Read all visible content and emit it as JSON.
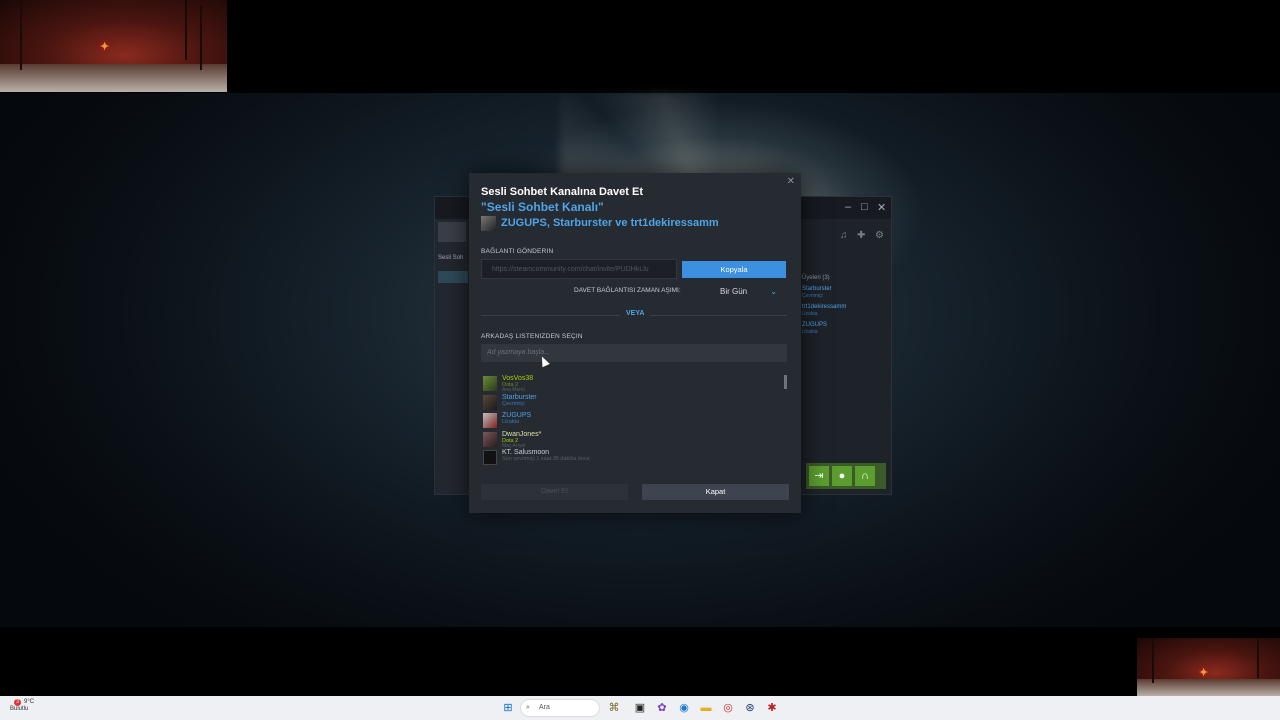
{
  "dialog": {
    "title": "Sesli Sohbet Kanalına Davet Et",
    "channel_name": "\"Sesli Sohbet Kanalı\"",
    "members": "ZUGUPS, Starburster ve trt1dekiressamm",
    "send_link_label": "BAĞLANTI GÖNDERIN",
    "invite_link": "https://steamcommunity.com/chat/invite/PUDHkLlu",
    "copy_label": "Kopyala",
    "expiry_label": "DAVET BAĞLANTISI ZAMAN AŞIMI:",
    "expiry_value": "Bir Gün",
    "or_label": "VEYA",
    "pick_friends_label": "ARKADAŞ LISTENIZDEN SEÇIN",
    "search_placeholder": "Ad yazmaya başla...",
    "invite_button": "Davet Et",
    "close_button": "Kapat"
  },
  "friends": [
    {
      "name": "VosVos38",
      "status": "Dota 2",
      "detail": "Ana Menü",
      "name_color": "#a3cf06",
      "status_color": "#6d8f1a"
    },
    {
      "name": "Starburster",
      "status": "Çevrimiçi",
      "detail": "",
      "name_color": "#4ea4e8",
      "status_color": "#3a7cb8"
    },
    {
      "name": "ZUGUPS",
      "status": "Uzakta",
      "detail": "",
      "name_color": "#4ea4e8",
      "status_color": "#3a7cb8"
    },
    {
      "name": "DwanJones*",
      "status": "Dota 2",
      "detail": "Maç Arıyor",
      "name_color": "#a3cf06",
      "status_color": "#6d8f1a"
    },
    {
      "name": "KT. Salusmoon",
      "status": "Son çevrimiçi 1 saat 35 dakika önce",
      "detail": "",
      "name_color": "#c6cdd3",
      "status_color": "#5a6168"
    }
  ],
  "background_window": {
    "voice_label": "Sesli Soh",
    "members_header": "Üyeleri (3)",
    "members": [
      {
        "name": "Starburster",
        "status": "Çevrimiçi"
      },
      {
        "name": "trt1dekiressamm",
        "status": "Uzakta"
      },
      {
        "name": "ZUGUPS",
        "status": "Uzakta"
      }
    ]
  },
  "taskbar": {
    "weather_temp": "9°C",
    "weather_desc": "Bulutlu",
    "search_placeholder": "Ara",
    "notification_count": "3"
  },
  "colors": {
    "accent_blue": "#4ea4e8",
    "copy_button": "#3d8fe0",
    "ingame_green": "#a3cf06",
    "voice_green": "#5c9e2e"
  }
}
